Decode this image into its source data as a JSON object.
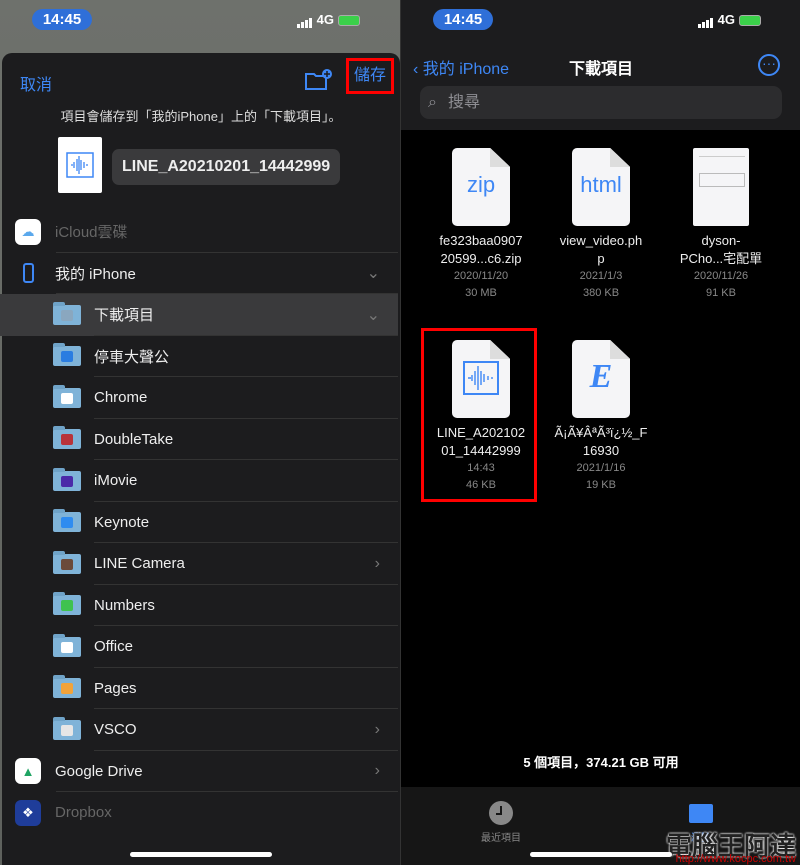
{
  "status": {
    "time": "14:45",
    "network": "4G"
  },
  "save_sheet": {
    "cancel": "取消",
    "save": "儲存",
    "hint": "項目會儲存到「我的iPhone」上的「下載項目」。",
    "filename": "LINE_A20210201_14442999",
    "locations": [
      {
        "label": "iCloud雲碟",
        "type": "app",
        "icon": "icloud-icon",
        "dim": true
      },
      {
        "label": "我的 iPhone",
        "type": "app",
        "icon": "iphone-icon",
        "chevron": "down"
      },
      {
        "label": "下載項目",
        "type": "folder",
        "icon": "download-icon",
        "chevron": "down",
        "selected": true,
        "color": "#8aa7bf"
      },
      {
        "label": "停車大聲公",
        "type": "folder",
        "icon": "parking-app-icon",
        "color": "#2a7de1"
      },
      {
        "label": "Chrome",
        "type": "folder",
        "icon": "chrome-icon",
        "color": "#ffffff"
      },
      {
        "label": "DoubleTake",
        "type": "folder",
        "icon": "doubletake-icon",
        "color": "#b8333a"
      },
      {
        "label": "iMovie",
        "type": "folder",
        "icon": "imovie-icon",
        "color": "#4b2aa8"
      },
      {
        "label": "Keynote",
        "type": "folder",
        "icon": "keynote-icon",
        "color": "#2f8cf0"
      },
      {
        "label": "LINE Camera",
        "type": "folder",
        "icon": "line-camera-icon",
        "chevron": "right",
        "color": "#6b4a3a"
      },
      {
        "label": "Numbers",
        "type": "folder",
        "icon": "numbers-icon",
        "color": "#3fc24f"
      },
      {
        "label": "Office",
        "type": "folder",
        "icon": "office-icon",
        "color": "#ffffff"
      },
      {
        "label": "Pages",
        "type": "folder",
        "icon": "pages-icon",
        "color": "#f2a33a"
      },
      {
        "label": "VSCO",
        "type": "folder",
        "icon": "vsco-icon",
        "chevron": "right",
        "color": "#e6e6e6"
      },
      {
        "label": "Google Drive",
        "type": "app",
        "icon": "google-drive-icon",
        "chevron": "right"
      },
      {
        "label": "Dropbox",
        "type": "app",
        "icon": "dropbox-icon",
        "dim": true
      }
    ]
  },
  "browser": {
    "back": "我的 iPhone",
    "title": "下載項目",
    "search_placeholder": "搜尋",
    "files": [
      {
        "name1": "fe323baa0907",
        "name2": "20599...c6.zip",
        "date": "2020/11/20",
        "size": "30 MB",
        "kind": "zip",
        "ext": "zip"
      },
      {
        "name1": "view_video.ph",
        "name2": "p",
        "date": "2021/1/3",
        "size": "380 KB",
        "kind": "html",
        "ext": "html"
      },
      {
        "name1": "dyson-",
        "name2": "PCho...宅配單",
        "date": "2020/11/26",
        "size": "91 KB",
        "kind": "pdf-thumb"
      },
      {
        "name1": "LINE_A202102",
        "name2": "01_14442999",
        "date": "14:43",
        "size": "46 KB",
        "kind": "audio",
        "highlighted": true
      },
      {
        "name1": "Ã¡Ã¥ÂªÃ³ï¿½_F",
        "name2": "16930",
        "date": "2021/1/16",
        "size": "19 KB",
        "kind": "epub",
        "ext": "E"
      }
    ],
    "footer": "5 個項目，374.21 GB 可用",
    "tabs": [
      {
        "label": "最近項目",
        "icon": "clock-icon"
      },
      {
        "label": "瀏覽",
        "icon": "folder-icon",
        "active": true
      }
    ]
  },
  "watermark": {
    "text": "電腦王阿達",
    "url": "http://www.kocpc.com.tw"
  },
  "colors": {
    "accent": "#3e87f5",
    "highlight": "#ff0000"
  }
}
